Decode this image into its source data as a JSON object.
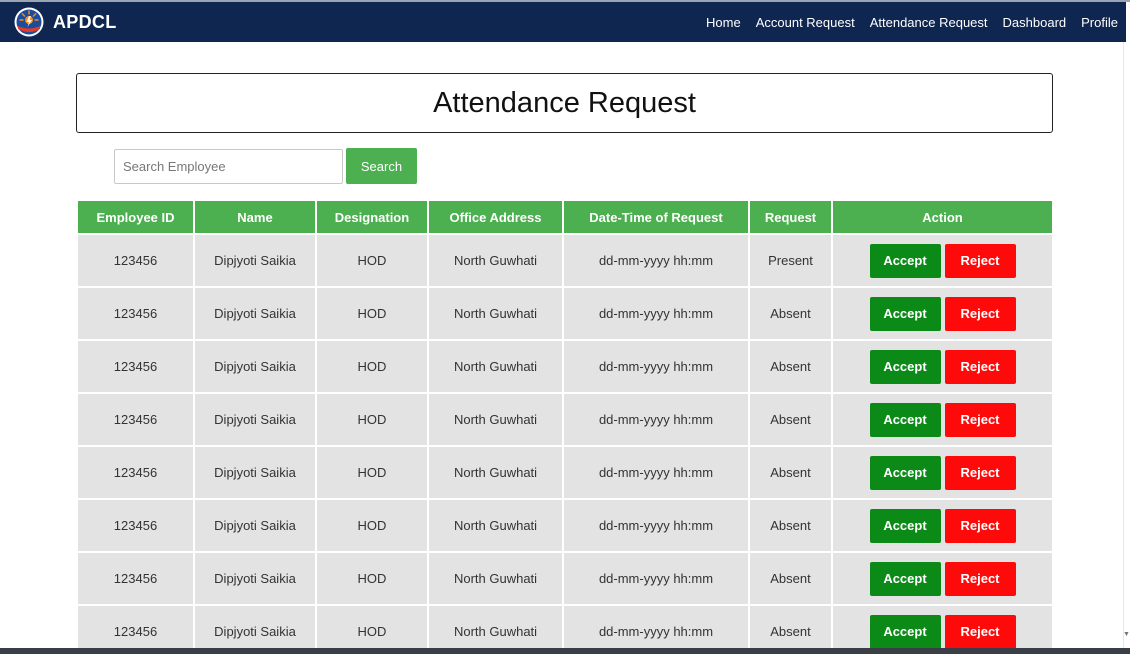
{
  "colors": {
    "navbar": "#0f2650",
    "accent_green": "#4caf50",
    "accept": "#0b8a18",
    "reject": "#ff0a0a",
    "row_bg": "#e3e3e3"
  },
  "navbar": {
    "brand": "APDCL",
    "links": [
      "Home",
      "Account Request",
      "Attendance Request",
      "Dashboard",
      "Profile"
    ]
  },
  "page": {
    "title": "Attendance Request"
  },
  "search": {
    "placeholder": "Search Employee",
    "value": "",
    "button_label": "Search"
  },
  "table": {
    "columns": [
      "Employee ID",
      "Name",
      "Designation",
      "Office Address",
      "Date-Time of Request",
      "Request",
      "Action"
    ],
    "accept_label": "Accept",
    "reject_label": "Reject",
    "rows": [
      {
        "id": "123456",
        "name": "Dipjyoti Saikia",
        "designation": "HOD",
        "office": "North Guwhati",
        "datetime": "dd-mm-yyyy hh:mm",
        "request": "Present"
      },
      {
        "id": "123456",
        "name": "Dipjyoti Saikia",
        "designation": "HOD",
        "office": "North Guwhati",
        "datetime": "dd-mm-yyyy hh:mm",
        "request": "Absent"
      },
      {
        "id": "123456",
        "name": "Dipjyoti Saikia",
        "designation": "HOD",
        "office": "North Guwhati",
        "datetime": "dd-mm-yyyy hh:mm",
        "request": "Absent"
      },
      {
        "id": "123456",
        "name": "Dipjyoti Saikia",
        "designation": "HOD",
        "office": "North Guwhati",
        "datetime": "dd-mm-yyyy hh:mm",
        "request": "Absent"
      },
      {
        "id": "123456",
        "name": "Dipjyoti Saikia",
        "designation": "HOD",
        "office": "North Guwhati",
        "datetime": "dd-mm-yyyy hh:mm",
        "request": "Absent"
      },
      {
        "id": "123456",
        "name": "Dipjyoti Saikia",
        "designation": "HOD",
        "office": "North Guwhati",
        "datetime": "dd-mm-yyyy hh:mm",
        "request": "Absent"
      },
      {
        "id": "123456",
        "name": "Dipjyoti Saikia",
        "designation": "HOD",
        "office": "North Guwhati",
        "datetime": "dd-mm-yyyy hh:mm",
        "request": "Absent"
      },
      {
        "id": "123456",
        "name": "Dipjyoti Saikia",
        "designation": "HOD",
        "office": "North Guwhati",
        "datetime": "dd-mm-yyyy hh:mm",
        "request": "Absent"
      }
    ]
  }
}
